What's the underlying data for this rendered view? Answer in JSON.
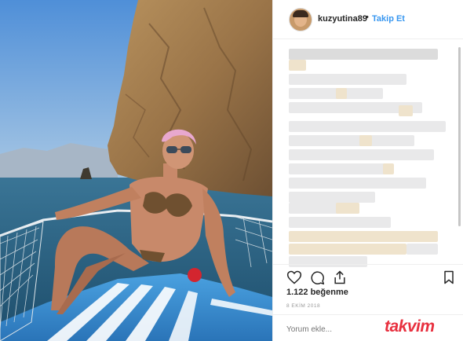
{
  "post": {
    "username": "kuzyutina89",
    "separator": "•",
    "follow_label": "Takip Et",
    "likes_text": "1.122 beğenme",
    "date_text": "8 EKİM 2018",
    "comment_placeholder": "Yorum ekle..."
  },
  "icons": {
    "like": "heart-icon",
    "comment": "comment-bubble-icon",
    "share": "share-icon",
    "save": "bookmark-icon"
  },
  "watermark": {
    "text": "takvim"
  },
  "colors": {
    "follow_blue": "#3897f0",
    "watermark_red": "#e8303f",
    "sea": "#2e6a8e",
    "sky": "#7fb0e0"
  }
}
